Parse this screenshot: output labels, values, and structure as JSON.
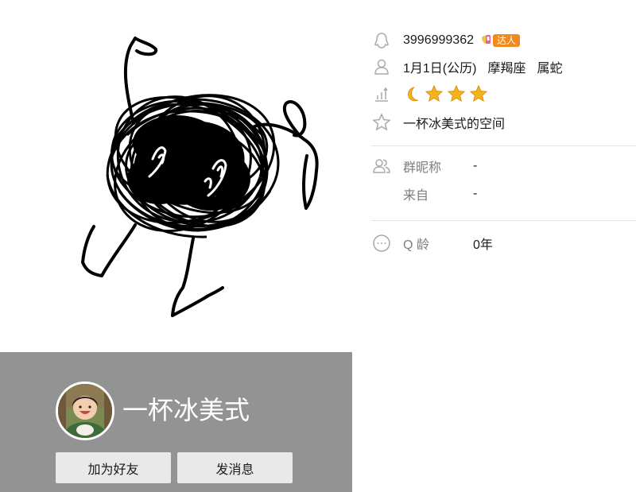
{
  "profile": {
    "nickname": "一杯冰美式",
    "qq_number": "3996999362",
    "badge_label": "达人",
    "birthday": "1月1日(公历)",
    "zodiac": "摩羯座",
    "chinese_zodiac": "属蛇",
    "level_icons": [
      "moon-icon",
      "star-icon",
      "star-icon",
      "star-icon"
    ],
    "space_link": "一杯冰美式的空间"
  },
  "group_info": {
    "group_nickname_label": "群昵称",
    "group_nickname_value": "-",
    "source_label": "来自",
    "source_value": "-"
  },
  "q_age": {
    "label": "Q 龄",
    "value": "0年"
  },
  "actions": {
    "add_friend": "加为好友",
    "send_message": "发消息"
  },
  "colors": {
    "card_bg": "#939393",
    "button_bg": "#e9e9e9",
    "icon_gray": "#a9a9a9",
    "star": "#f5b21b",
    "badge": "#f08a1c"
  }
}
